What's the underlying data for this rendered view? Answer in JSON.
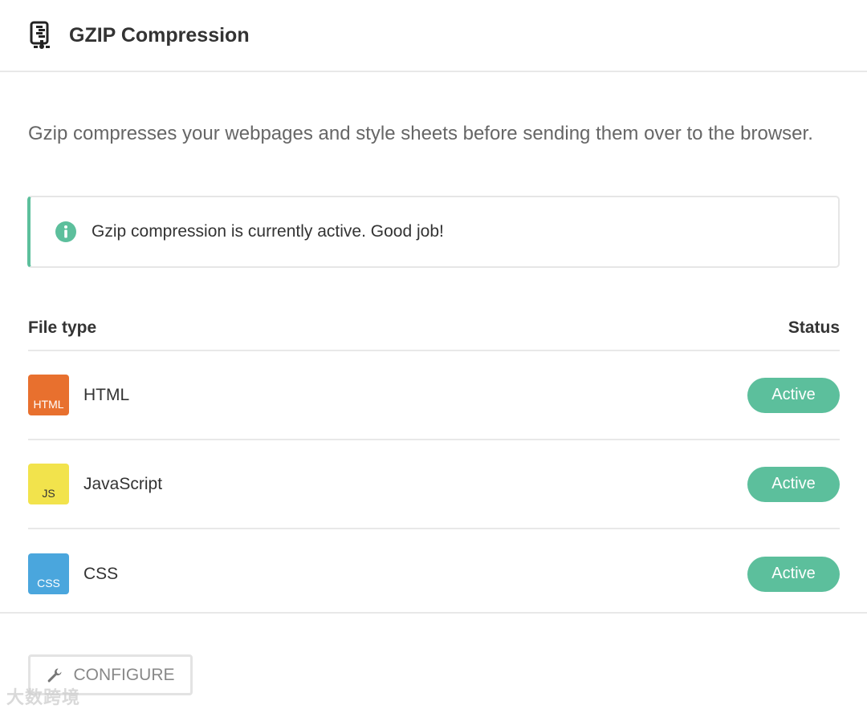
{
  "header": {
    "title": "GZIP Compression",
    "icon": "compress-icon"
  },
  "description": "Gzip compresses your webpages and style sheets before sending them over to the browser.",
  "notice": {
    "icon": "info-icon",
    "text": "Gzip compression is currently active. Good job!",
    "accent_color": "#5cbf9c"
  },
  "table": {
    "headers": {
      "file_type": "File type",
      "status": "Status"
    },
    "rows": [
      {
        "badge": "HTML",
        "name": "HTML",
        "status": "Active",
        "badge_color": "#e8702e",
        "badge_text_color": "#ffffff"
      },
      {
        "badge": "JS",
        "name": "JavaScript",
        "status": "Active",
        "badge_color": "#f2e34c",
        "badge_text_color": "#333333"
      },
      {
        "badge": "CSS",
        "name": "CSS",
        "status": "Active",
        "badge_color": "#4aa6dd",
        "badge_text_color": "#ffffff"
      }
    ]
  },
  "actions": {
    "configure_label": "CONFIGURE",
    "configure_icon": "wrench-icon"
  },
  "watermark": "大数跨境",
  "colors": {
    "active": "#5cbf9c",
    "divider": "#e8e8e8"
  }
}
